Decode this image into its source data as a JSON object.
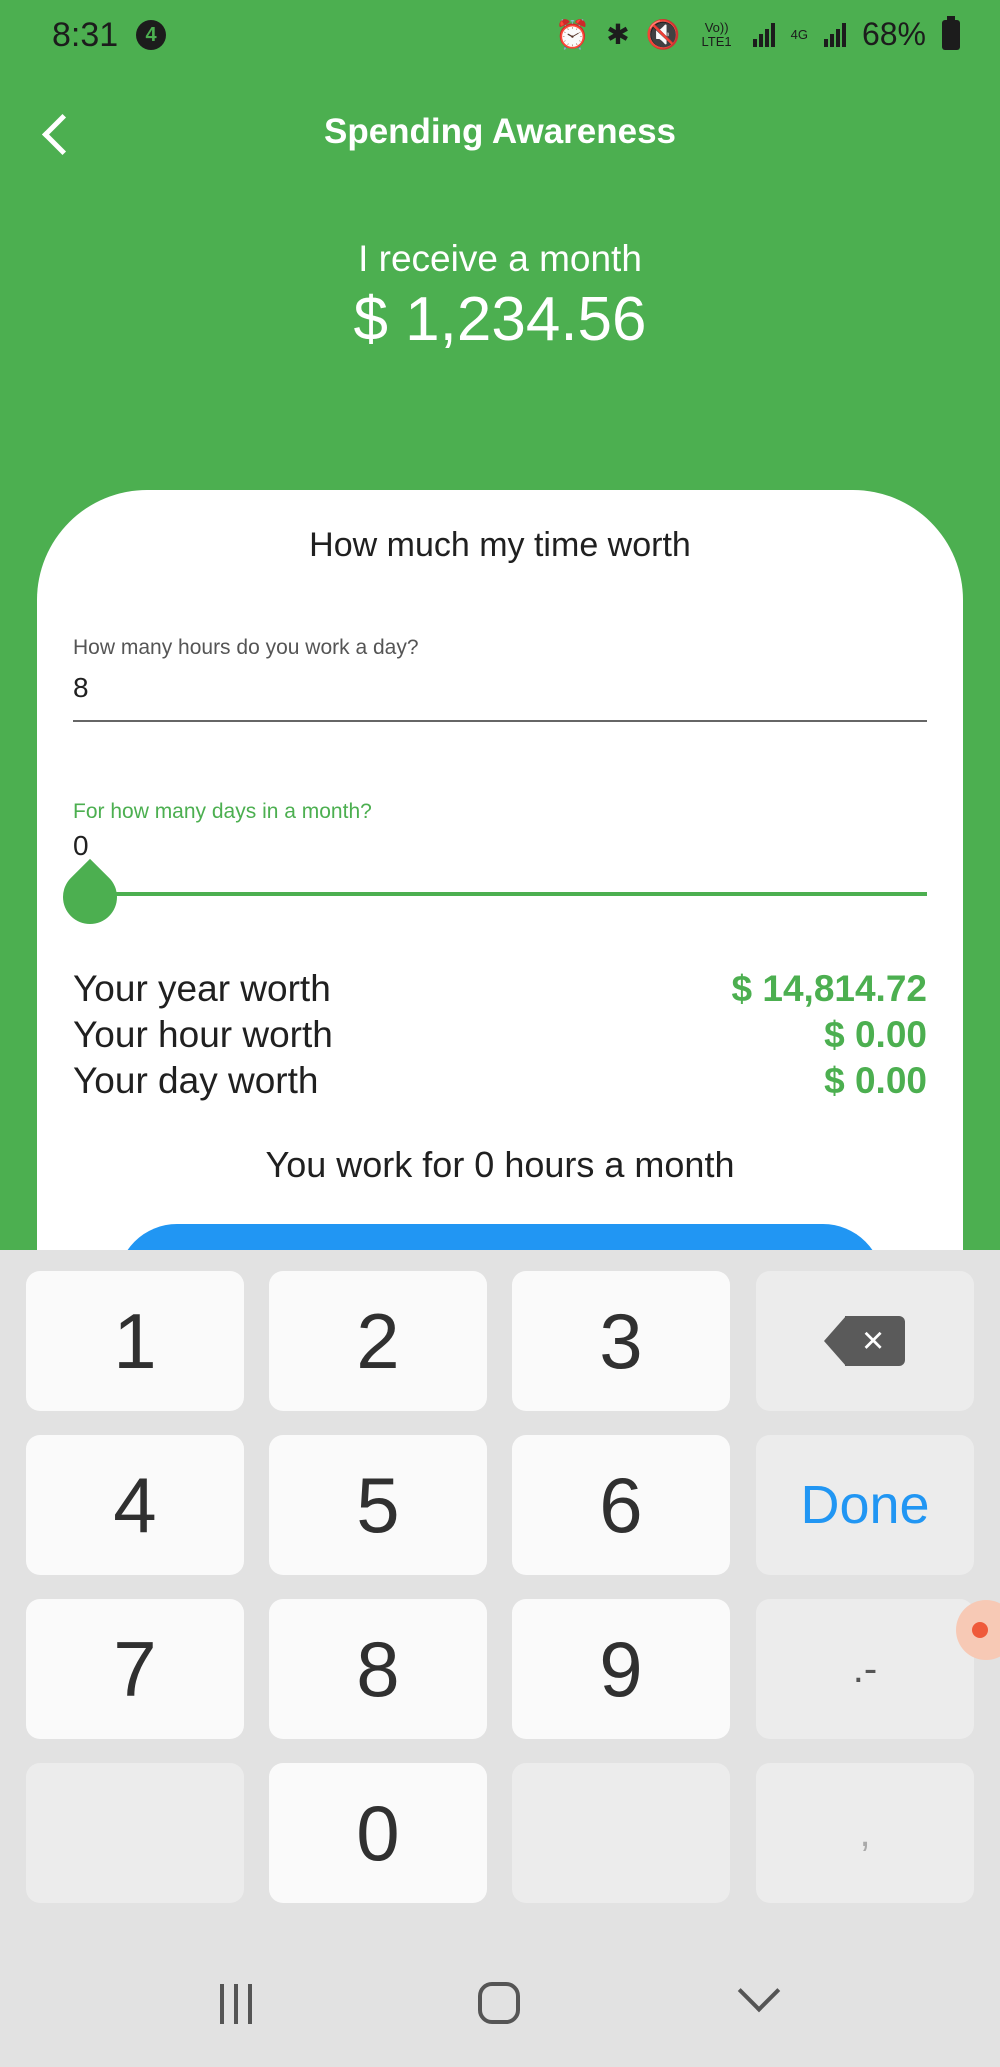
{
  "status_bar": {
    "time": "8:31",
    "notification_count": "4",
    "volte_label": "Vo)) LTE1",
    "network_label": "4G",
    "battery": "68%"
  },
  "app_bar": {
    "title": "Spending Awareness"
  },
  "income": {
    "label": "I receive a month",
    "value": "$ 1,234.56"
  },
  "card": {
    "title": "How much my time worth",
    "hours_field": {
      "label": "How many hours do you work a day?",
      "value": "8"
    },
    "days_field": {
      "label": "For how many days in a month?",
      "value": "0",
      "slider_fraction": 0
    },
    "stats": [
      {
        "label": "Your year worth",
        "value": "$ 14,814.72"
      },
      {
        "label": "Your hour worth",
        "value": "$ 0.00"
      },
      {
        "label": "Your day worth",
        "value": "$ 0.00"
      }
    ],
    "hours_summary": "You work for 0 hours a month"
  },
  "keyboard": {
    "keys": [
      "1",
      "2",
      "3",
      "4",
      "5",
      "6",
      "7",
      "8",
      "9",
      "0"
    ],
    "backspace_symbol": "×",
    "done_label": "Done",
    "dot_dash_label": ".-",
    "comma_label": ","
  },
  "colors": {
    "primary_green": "#4caf50",
    "accent_blue": "#2196f3"
  }
}
